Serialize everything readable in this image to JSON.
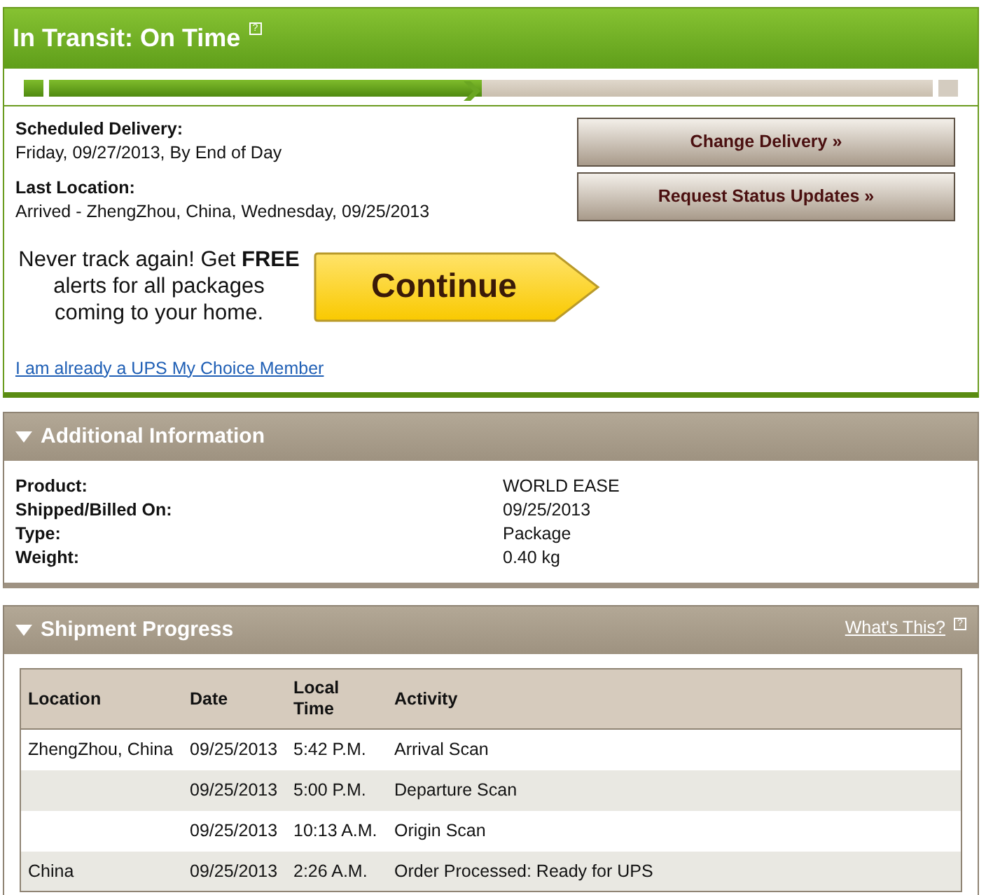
{
  "status": {
    "title": "In Transit: On Time",
    "help": "?",
    "progress": {
      "level": 0.49
    }
  },
  "delivery": [
    {
      "label": "Scheduled Delivery:",
      "value": "Friday, 09/27/2013, By End of Day"
    },
    {
      "label": "Last Location:",
      "value": "Arrived - ZhengZhou, China, Wednesday, 09/25/2013"
    }
  ],
  "actions": [
    "Change Delivery »",
    "Request Status Updates »"
  ],
  "promo": {
    "text": "Never track again! Get **FREE** alerts for all packages coming to your home.",
    "button": "Continue",
    "link": "I am already a UPS My Choice Member"
  },
  "additional_information": {
    "title": "Additional Information",
    "expanded": true,
    "fields": [
      {
        "label": "Product:",
        "value": "WORLD EASE"
      },
      {
        "label": "Shipped/Billed On:",
        "value": "09/25/2013"
      },
      {
        "label": "Type:",
        "value": "Package"
      },
      {
        "label": "Weight:",
        "value": "0.40 kg"
      }
    ]
  },
  "shipment_progress": {
    "title": "Shipment Progress",
    "expanded": true,
    "help_link": "What's This?",
    "help": "?",
    "columns": [
      "Location",
      "Date",
      "Local Time",
      "Activity"
    ],
    "rows": [
      [
        "ZhengZhou, China",
        "09/25/2013",
        "5:42 P.M.",
        "Arrival Scan"
      ],
      [
        "",
        "09/25/2013",
        "5:00 P.M.",
        "Departure Scan"
      ],
      [
        "",
        "09/25/2013",
        "10:13 A.M.",
        "Origin Scan"
      ],
      [
        "China",
        "09/25/2013",
        "2:26 A.M.",
        "Order Processed: Ready for UPS"
      ]
    ]
  }
}
